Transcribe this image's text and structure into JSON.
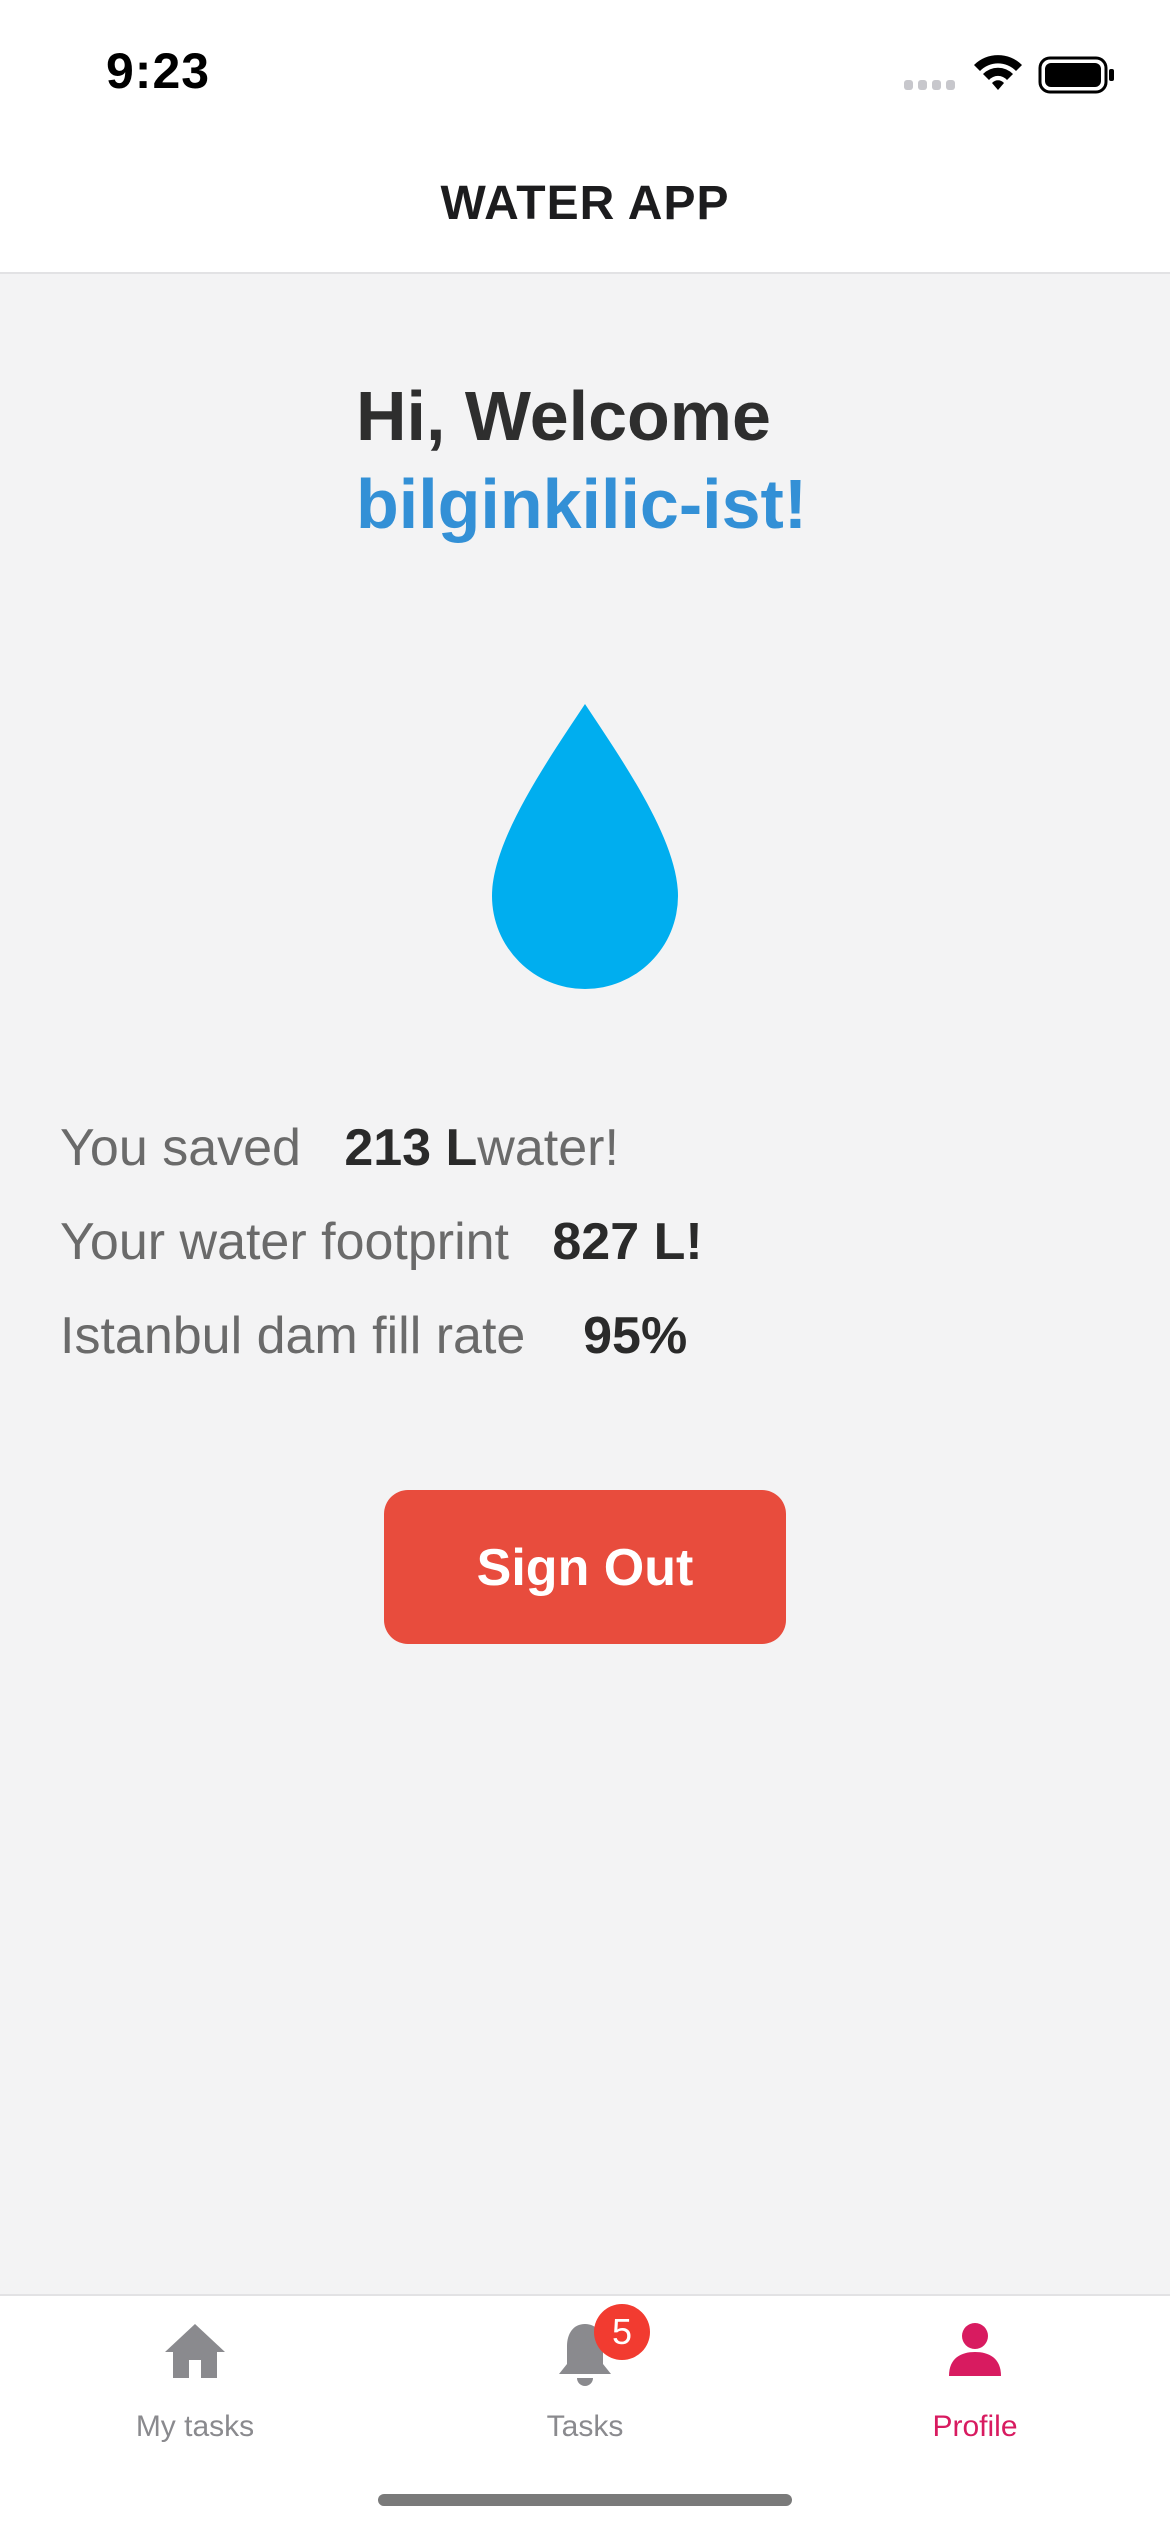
{
  "status_bar": {
    "time": "9:23",
    "icons": [
      "cellular-signal-icon",
      "wifi-icon",
      "battery-icon"
    ]
  },
  "header": {
    "title": "WATER APP"
  },
  "main": {
    "greeting": "Hi, Welcome",
    "username": "bilginkilic-ist!",
    "drop_icon": "water-drop-icon",
    "stats": [
      {
        "label": "You saved",
        "value": "213 L",
        "suffix": "water!"
      },
      {
        "label": "Your water footprint",
        "value": "827 L!",
        "suffix": ""
      },
      {
        "label": "Istanbul dam fill rate",
        "value": "95%",
        "suffix": ""
      }
    ],
    "sign_out_label": "Sign Out"
  },
  "tab_bar": {
    "tabs": [
      {
        "label": "My tasks",
        "icon": "home-icon",
        "active": false
      },
      {
        "label": "Tasks",
        "icon": "bell-icon",
        "badge": "5",
        "active": false
      },
      {
        "label": "Profile",
        "icon": "person-icon",
        "active": true
      }
    ]
  },
  "colors": {
    "accent_blue": "#3390d6",
    "drop_blue": "#00aeef",
    "sign_out_red": "#e84c3d",
    "active_tab": "#d81b60",
    "badge_red": "#f23b30",
    "background": "#f3f3f4"
  }
}
